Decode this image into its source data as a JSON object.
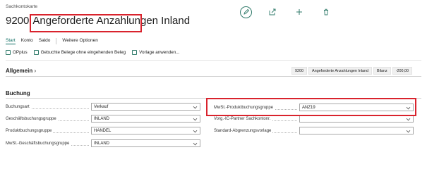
{
  "page": {
    "kicker": "Sachkontokarte",
    "number": "9200",
    "name": "Angeforderte Anzahlungen Inland"
  },
  "actions": [
    {
      "name": "edit-icon"
    },
    {
      "name": "share-icon"
    },
    {
      "name": "add-icon"
    },
    {
      "name": "delete-icon"
    }
  ],
  "tabs": {
    "start": "Start",
    "konto": "Konto",
    "saldo": "Saldo",
    "more": "Weitere Optionen"
  },
  "commands": {
    "opplus": "OPplus",
    "gebuchte": "Gebuchte Belege ohne eingehenden Beleg",
    "vorlage": "Vorlage anwenden..."
  },
  "general": {
    "title": "Allgemein",
    "summary_no": "9200",
    "summary_name": "Angeforderte Anzahlungen Inland",
    "summary_type": "Bilanz",
    "summary_balance": "-200,00"
  },
  "buchung": {
    "title": "Buchung",
    "left": [
      {
        "label": "Buchungsart",
        "value": "Verkauf"
      },
      {
        "label": "Geschäftsbuchungsgruppe",
        "value": "INLAND"
      },
      {
        "label": "Produktbuchungsgruppe",
        "value": "HANDEL"
      },
      {
        "label": "MwSt.-Geschäftsbuchungsgruppe",
        "value": "INLAND"
      }
    ],
    "right": [
      {
        "label": "MwSt.-Produktbuchungsgruppe",
        "value": "ANZ19"
      },
      {
        "label": "Vorg.-IC-Partner Sachkontonr.",
        "value": ""
      },
      {
        "label": "Standard-Abgrenzungsvorlage",
        "value": ""
      }
    ]
  },
  "colors": {
    "accent": "#0b6c61",
    "highlight": "#d9232d"
  }
}
